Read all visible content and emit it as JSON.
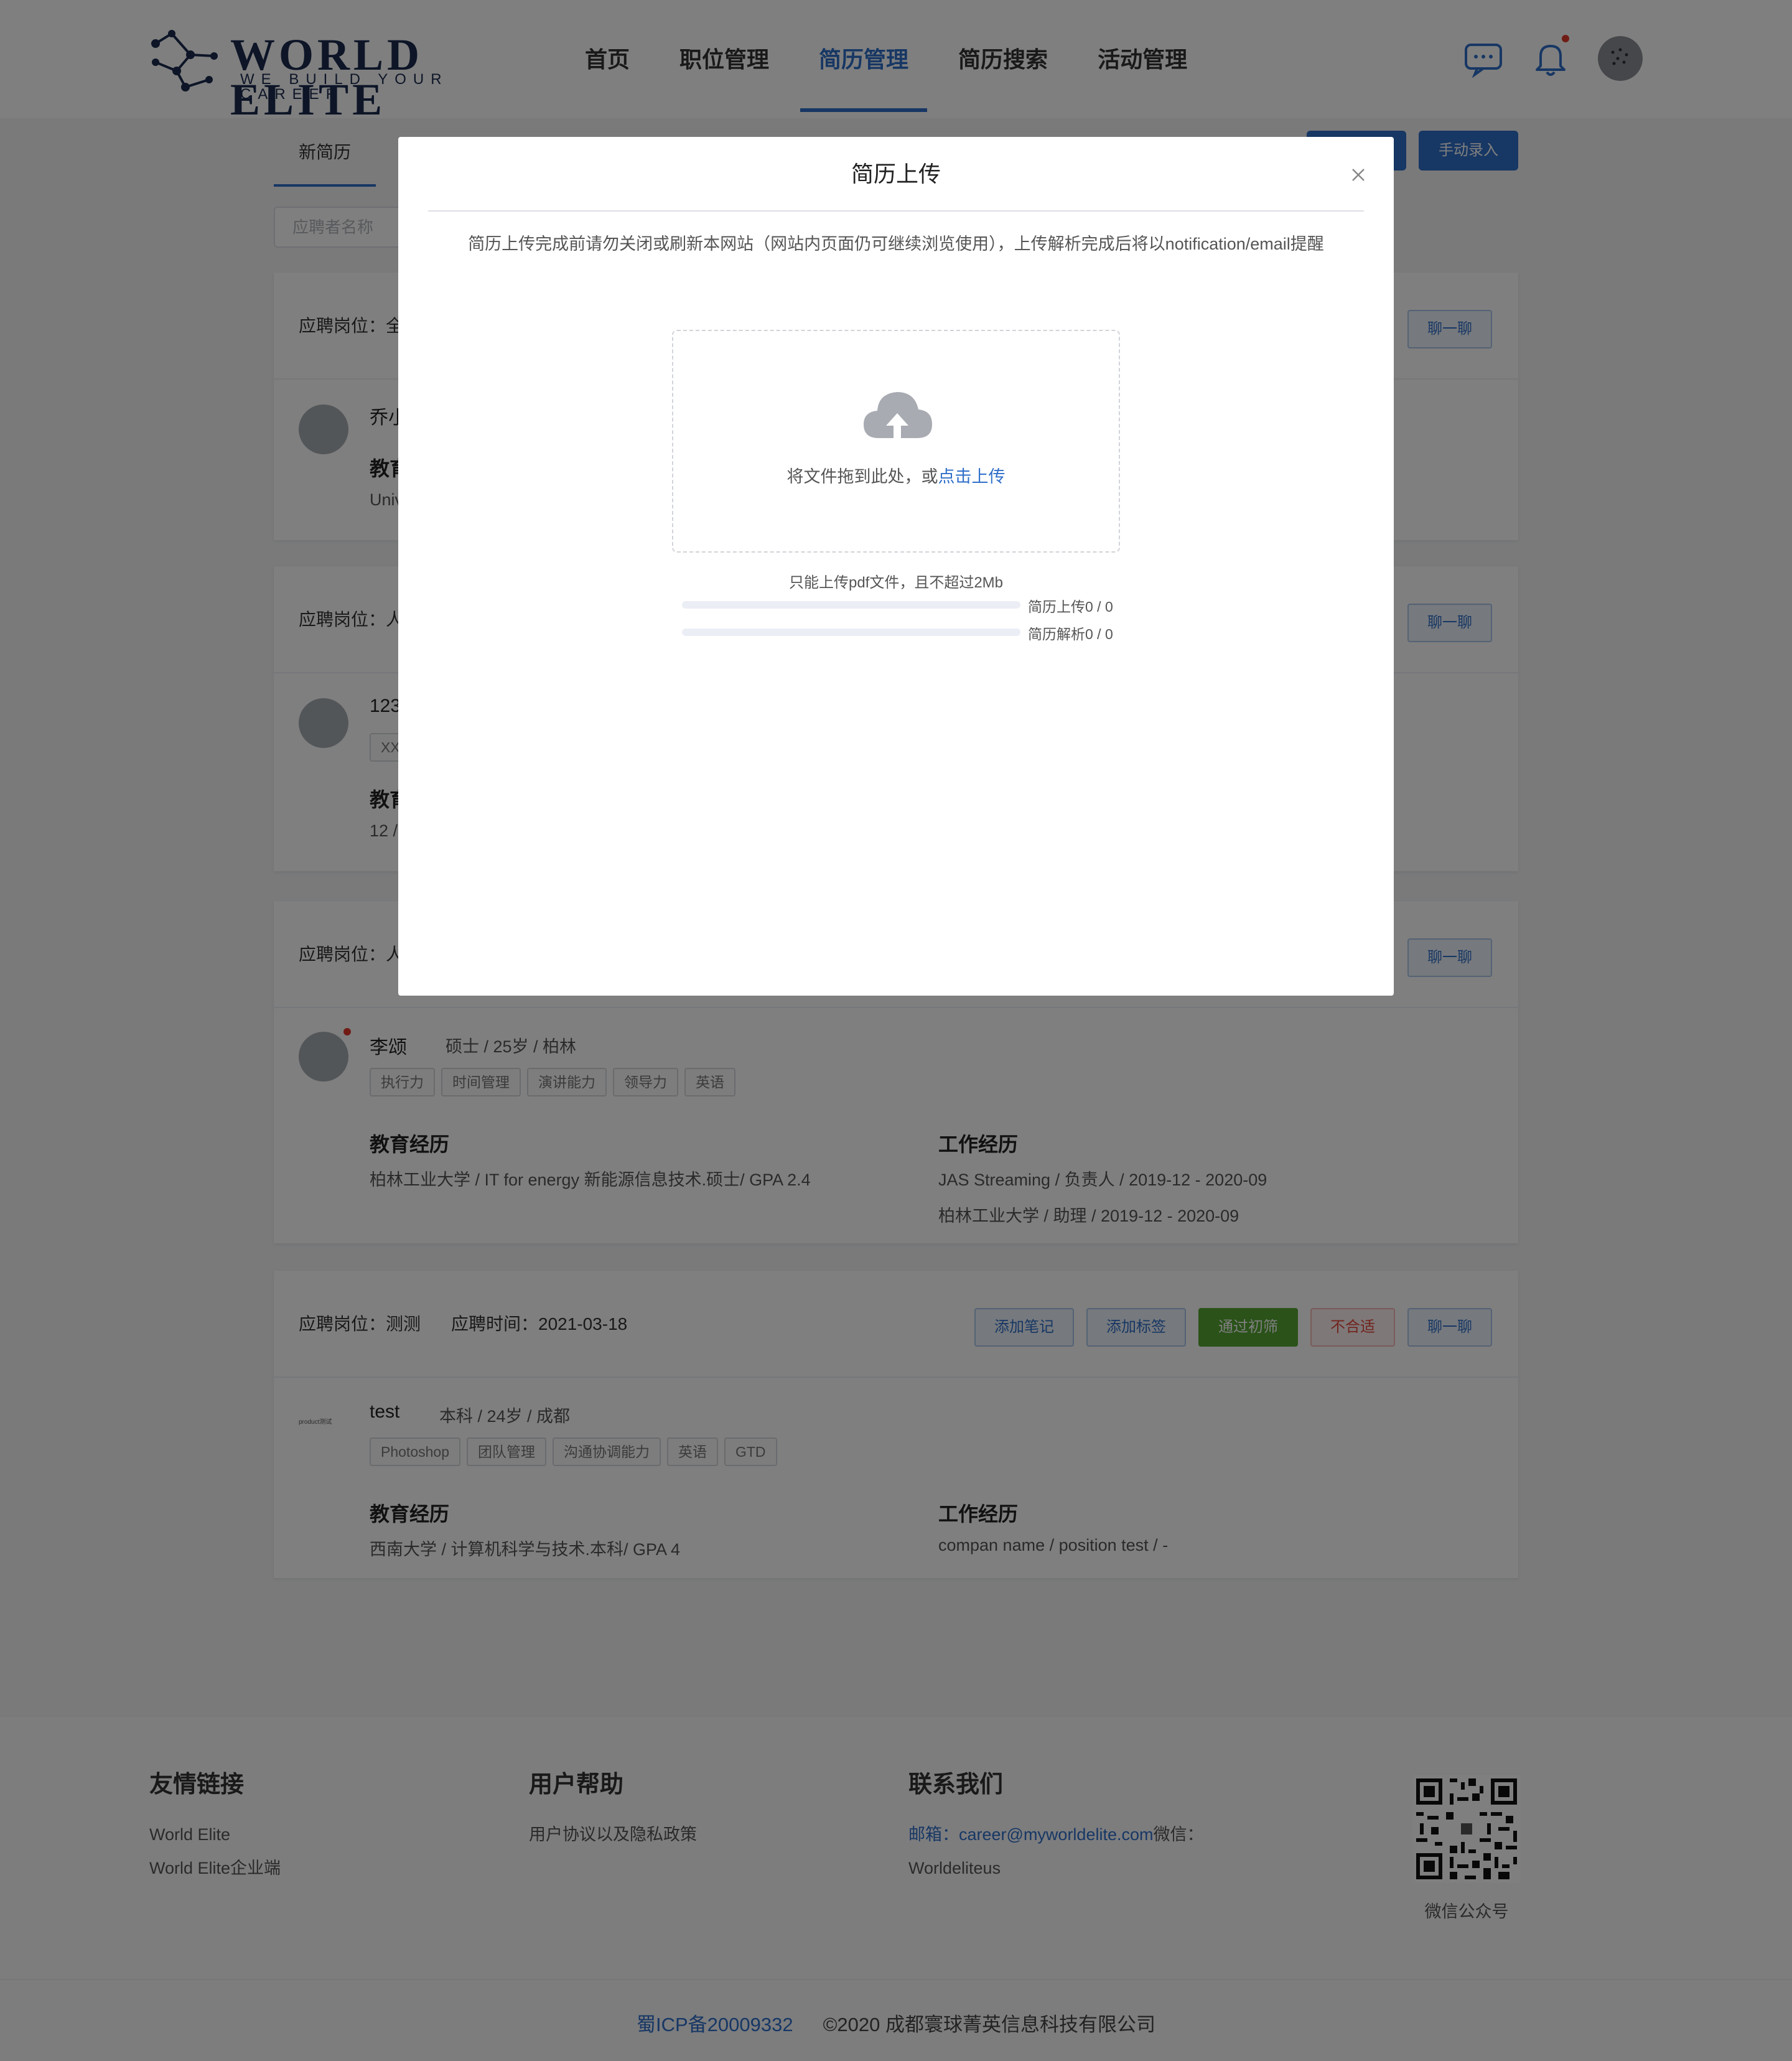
{
  "brand": {
    "name": "WORLD ELITE",
    "tagline": "WE BUILD YOUR CAREER"
  },
  "nav": {
    "items": [
      {
        "label": "首页"
      },
      {
        "label": "职位管理"
      },
      {
        "label": "简历管理",
        "active": true
      },
      {
        "label": "简历搜索"
      },
      {
        "label": "活动管理"
      }
    ]
  },
  "header_icons": [
    "message-icon",
    "bell-icon",
    "avatar"
  ],
  "page": {
    "tab_new": "新简历",
    "manual_entry_button": "手动录入",
    "search_placeholder": "应聘者名称"
  },
  "cards": [
    {
      "position_label": "应聘岗位：全",
      "chat_button": "聊一聊",
      "name": "乔小",
      "edu_title": "教育",
      "edu_line": "Univ"
    },
    {
      "position_label": "应聘岗位：人",
      "chat_button": "聊一聊",
      "name": "123",
      "tag": "XX",
      "edu_title": "教育",
      "edu_line": "12 /"
    },
    {
      "position_label": "应聘岗位：人",
      "chat_button": "聊一聊",
      "name": "李颂",
      "info": "硕士 / 25岁 / 柏林",
      "tags": [
        "执行力",
        "时间管理",
        "演讲能力",
        "领导力",
        "英语"
      ],
      "edu_title": "教育经历",
      "edu_lines": [
        "柏林工业大学 / IT for energy 新能源信息技术.硕士/ GPA 2.4"
      ],
      "work_title": "工作经历",
      "work_lines": [
        "JAS Streaming / 负责人 / 2019-12 - 2020-09",
        "柏林工业大学 / 助理 / 2019-12 - 2020-09"
      ]
    },
    {
      "position_label": "应聘岗位：测测",
      "time_label": "应聘时间：2021-03-18",
      "buttons": {
        "note": "添加笔记",
        "tag": "添加标签",
        "pass": "通过初筛",
        "reject": "不合适",
        "chat": "聊一聊"
      },
      "avatar_text": "product测试",
      "name": "test",
      "info": "本科 / 24岁 / 成都",
      "tags": [
        "Photoshop",
        "团队管理",
        "沟通协调能力",
        "英语",
        "GTD"
      ],
      "edu_title": "教育经历",
      "edu_lines": [
        "西南大学 / 计算机科学与技术.本科/ GPA 4"
      ],
      "work_title": "工作经历",
      "work_lines": [
        "compan name / position test / -"
      ]
    }
  ],
  "footer": {
    "friend_links": {
      "title": "友情链接",
      "items": [
        "World Elite",
        "World Elite企业端"
      ]
    },
    "help": {
      "title": "用户帮助",
      "items": [
        "用户协议以及隐私政策"
      ]
    },
    "contact": {
      "title": "联系我们",
      "email_label": "邮箱：",
      "email": "career@myworldelite.com",
      "wechat_label": "微信：",
      "wechat": "Worldeliteus"
    },
    "qr_label": "微信公众号",
    "icp": "蜀ICP备20009332",
    "copyright": "©2020 成都寰球菁英信息科技有限公司"
  },
  "modal": {
    "title": "简历上传",
    "notice": "简历上传完成前请勿关闭或刷新本网站（网站内页面仍可继续浏览使用），上传解析完成后将以notification/email提醒",
    "drop_text": "将文件拖到此处，或",
    "drop_link": "点击上传",
    "limit_text": "只能上传pdf文件，且不超过2Mb",
    "upload_progress": {
      "label": "简历上传0 / 0",
      "done": 0,
      "total": 0
    },
    "parse_progress": {
      "label": "简历解析0 / 0",
      "done": 0,
      "total": 0
    }
  }
}
